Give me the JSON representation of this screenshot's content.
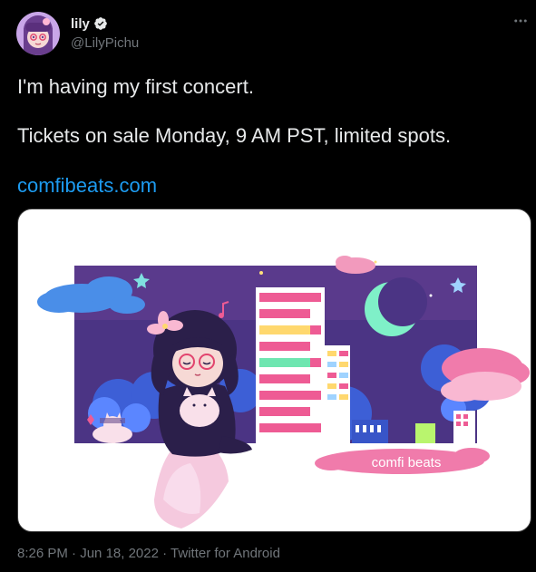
{
  "author": {
    "display_name": "lily",
    "handle": "@LilyPichu",
    "verified": true
  },
  "tweet": {
    "line1": "I'm having my first concert.",
    "line2": "Tickets on sale Monday, 9 AM PST, limited spots.",
    "link_text": "comfibeats.com"
  },
  "media": {
    "banner_text": "comfi beats"
  },
  "meta": {
    "time": "8:26 PM",
    "sep1": " · ",
    "date": "Jun 18, 2022",
    "sep2": " · ",
    "source": "Twitter for Android"
  },
  "icons": {
    "verified": "verified-badge-icon",
    "more": "more-horizontal-icon"
  },
  "colors": {
    "background": "#000000",
    "text": "#e7e9ea",
    "secondary": "#71767b",
    "link": "#1d9bf0"
  }
}
